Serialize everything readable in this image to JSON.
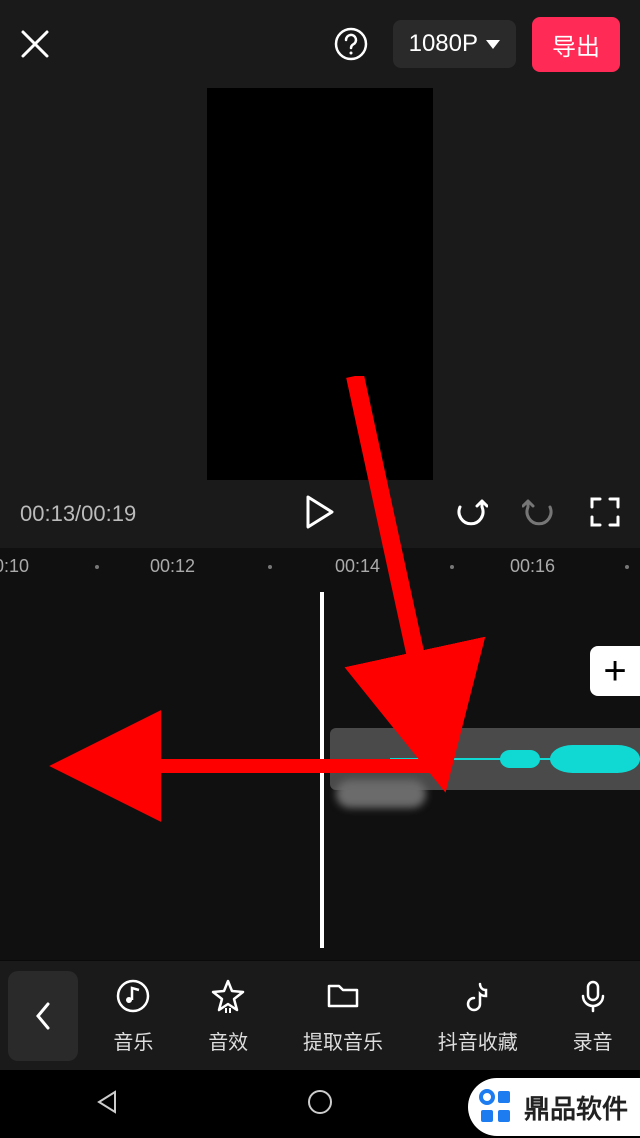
{
  "top": {
    "resolution": "1080P",
    "export": "导出"
  },
  "playback": {
    "current": "00:13",
    "total": "00:19",
    "timecode": "00:13/00:19"
  },
  "ruler": {
    "ticks": [
      "0:10",
      "00:12",
      "00:14",
      "00:16"
    ]
  },
  "plus": "+",
  "toolbar": {
    "music": "音乐",
    "sfx": "音效",
    "extract": "提取音乐",
    "douyin": "抖音收藏",
    "record": "录音"
  },
  "watermark": "鼎品软件"
}
